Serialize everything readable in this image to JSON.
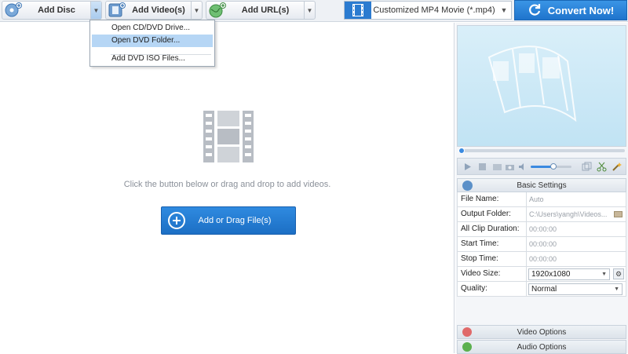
{
  "toolbar": {
    "add_disc_label": "Add Disc",
    "add_video_label": "Add Video(s)",
    "add_url_label": "Add URL(s)",
    "format_label": "Customized MP4 Movie (*.mp4)",
    "convert_label": "Convert Now!"
  },
  "disc_menu": {
    "items": [
      "Open CD/DVD Drive...",
      "Open DVD Folder...",
      "Add DVD ISO Files..."
    ],
    "active_index": 1
  },
  "main": {
    "hint": "Click the button below or drag and drop to add videos.",
    "add_button_label": "Add or Drag File(s)"
  },
  "player": {
    "volume_level": 0.55
  },
  "settings": {
    "header": "Basic Settings",
    "rows": [
      {
        "label": "File Name:",
        "value": "Auto"
      },
      {
        "label": "Output Folder:",
        "value": "C:\\Users\\yangh\\Videos..."
      },
      {
        "label": "All Clip Duration:",
        "value": "00:00:00"
      },
      {
        "label": "Start Time:",
        "value": "00:00:00"
      },
      {
        "label": "Stop Time:",
        "value": "00:00:00"
      },
      {
        "label": "Video Size:",
        "value": "1920x1080"
      },
      {
        "label": "Quality:",
        "value": "Normal"
      }
    ]
  },
  "options": {
    "video_label": "Video Options",
    "audio_label": "Audio Options"
  },
  "colors": {
    "accent": "#1f74cc",
    "menu_highlight": "#b6d6f5",
    "preview_bg": "#c1e3f4"
  }
}
